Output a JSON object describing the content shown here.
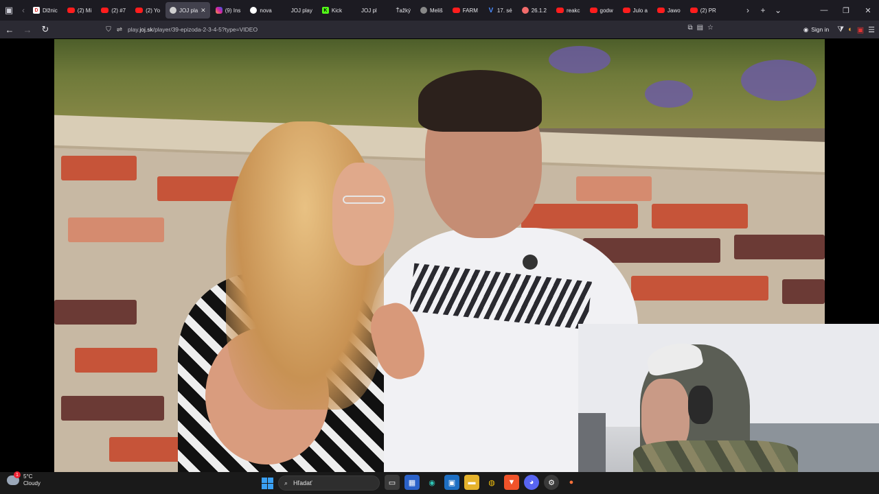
{
  "browser": {
    "tabs": [
      {
        "label": "Dlžnic",
        "icon": "document-icon"
      },
      {
        "label": "(2) Mi",
        "icon": "youtube-icon"
      },
      {
        "label": "(2) #7",
        "icon": "youtube-icon"
      },
      {
        "label": "(2) Yo",
        "icon": "youtube-icon"
      },
      {
        "label": "JOJ pla",
        "icon": "joj-icon",
        "active": true
      },
      {
        "label": "(9) Ins",
        "icon": "instagram-icon"
      },
      {
        "label": "nova",
        "icon": "nova-icon"
      },
      {
        "label": "JOJ play",
        "icon": "blank-icon"
      },
      {
        "label": "Kick",
        "icon": "kick-icon"
      },
      {
        "label": "JOJ pl",
        "icon": "blank-icon"
      },
      {
        "label": "Ťažký",
        "icon": "blank-icon"
      },
      {
        "label": "Meliš",
        "icon": "gray-icon"
      },
      {
        "label": "FARM",
        "icon": "youtube-icon"
      },
      {
        "label": "17. sé",
        "icon": "v-icon"
      },
      {
        "label": "26.1.2",
        "icon": "flower-icon"
      },
      {
        "label": "reakc",
        "icon": "youtube-icon"
      },
      {
        "label": "godw",
        "icon": "youtube-icon"
      },
      {
        "label": "Julo a",
        "icon": "youtube-icon"
      },
      {
        "label": "Jawo",
        "icon": "youtube-icon"
      },
      {
        "label": "(2) PR",
        "icon": "youtube-icon"
      }
    ],
    "url": {
      "prefix": "play.",
      "domain": "joj.sk",
      "path": "/player/39-epizoda-2-3-4-5?type=VIDEO"
    },
    "signin_label": "Sign in"
  },
  "taskbar": {
    "weather_temp": "5°C",
    "weather_desc": "Cloudy",
    "weather_badge": "1",
    "search_placeholder": "Hľadať"
  }
}
